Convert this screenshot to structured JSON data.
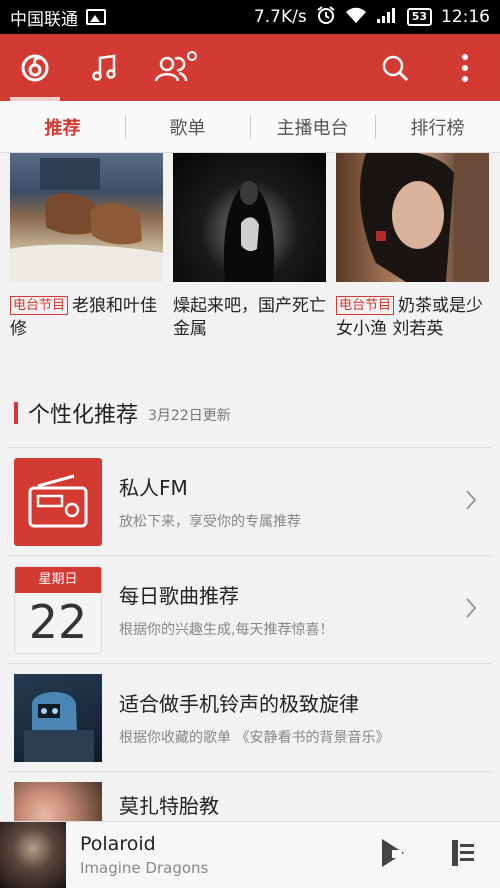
{
  "statusbar": {
    "carrier": "中国联通",
    "speed": "7.7K/s",
    "battery": "53",
    "time": "12:16"
  },
  "appbar": {
    "icons": [
      "music-logo-icon",
      "music-note-icon",
      "friends-icon",
      "search-icon",
      "more-icon"
    ]
  },
  "tabs": [
    {
      "label": "推荐",
      "active": true
    },
    {
      "label": "歌单",
      "active": false
    },
    {
      "label": "主播电台",
      "active": false
    },
    {
      "label": "排行榜",
      "active": false
    }
  ],
  "cards": [
    {
      "tag": "电台节目",
      "title": "老狼和叶佳修"
    },
    {
      "tag": "",
      "title": "燥起来吧，国产死亡金属"
    },
    {
      "tag": "电台节目",
      "title": "奶茶或是少女小渔 刘若英"
    }
  ],
  "section": {
    "title": "个性化推荐",
    "subtitle": "3月22日更新"
  },
  "rows": [
    {
      "title": "私人FM",
      "desc": "放松下来，享受你的专属推荐"
    },
    {
      "title": "每日歌曲推荐",
      "desc": "根据你的兴趣生成,每天推荐惊喜！",
      "cal_day": "星期日",
      "cal_num": "22"
    },
    {
      "title": "适合做手机铃声的极致旋律",
      "desc": "根据你收藏的歌单 《安静看书的背景音乐》"
    },
    {
      "title": "莫扎特胎教",
      "desc": ""
    }
  ],
  "player": {
    "song": "Polaroid",
    "artist": "Imagine Dragons"
  },
  "colors": {
    "accent": "#d33a31"
  }
}
